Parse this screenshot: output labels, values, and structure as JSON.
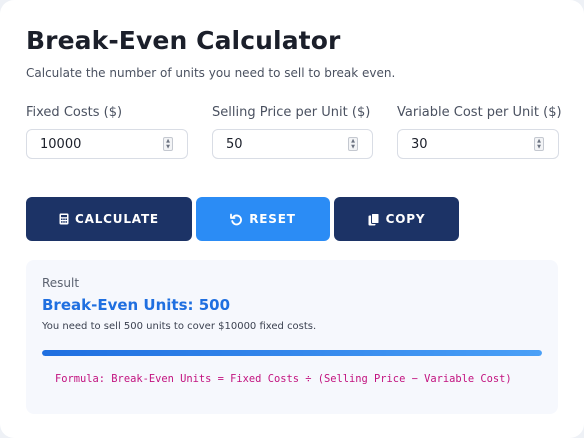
{
  "app": {
    "title": "Break-Even Calculator",
    "subtitle": "Calculate the number of units you need to sell to break even."
  },
  "fields": [
    {
      "label": "Fixed Costs ($)",
      "value": "10000"
    },
    {
      "label": "Selling Price per Unit ($)",
      "value": "50"
    },
    {
      "label": "Variable Cost per Unit ($)",
      "value": "30"
    }
  ],
  "buttons": {
    "calculate": {
      "label": "CALCULATE",
      "icon": "calculator-icon"
    },
    "reset": {
      "label": "RESET",
      "icon": "reset-icon"
    },
    "copy": {
      "label": "COPY",
      "icon": "copy-icon"
    }
  },
  "result": {
    "label": "Result",
    "value": "Break-Even Units: 500",
    "description": "You need to sell 500 units to cover $10000 fixed costs.",
    "progress": 1.0,
    "formula": "Formula: Break-Even Units = Fixed Costs ÷ (Selling Price − Variable Cost)"
  },
  "colors": {
    "primary_dark": "#1c3366",
    "primary_blue": "#2b8cf5",
    "result_value": "#1f6fe0",
    "formula": "#c2127f"
  }
}
